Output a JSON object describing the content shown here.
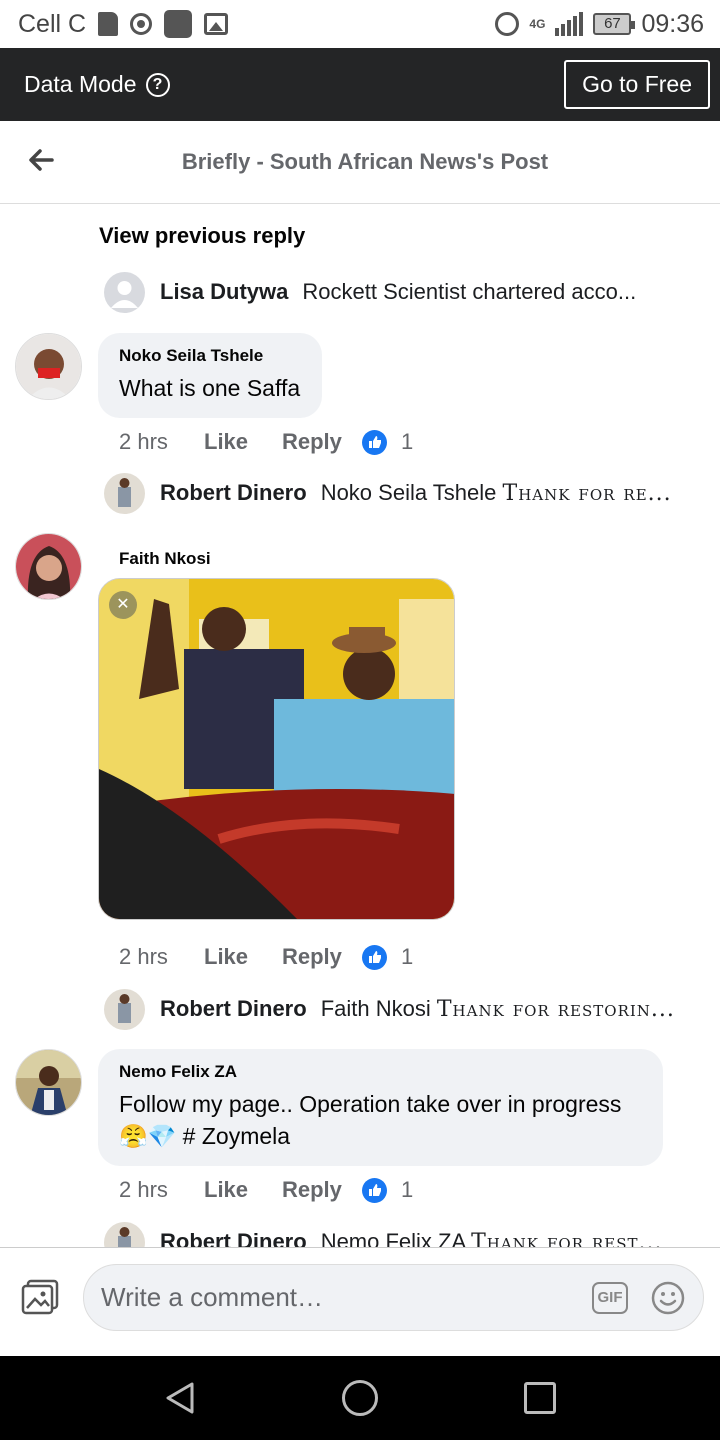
{
  "status_bar": {
    "carrier": "Cell C",
    "network": "4G",
    "battery": "67",
    "time": "09:36"
  },
  "data_mode": {
    "label": "Data Mode",
    "go_free_label": "Go to Free"
  },
  "header": {
    "title": "Briefly - South African News's Post"
  },
  "feed": {
    "view_previous_reply": "View previous reply",
    "reply_lisa": {
      "name": "Lisa Dutywa",
      "text": "Rockett Scientist chartered acco..."
    },
    "comment_noko": {
      "name": "Noko Seila Tshele",
      "text": "What is one Saffa",
      "time": "2 hrs",
      "like_label": "Like",
      "reply_label": "Reply",
      "reactions": "1"
    },
    "reply_robert_1": {
      "name": "Robert Dinero",
      "mention": "Noko Seila Tshele",
      "text": "Thank for re..."
    },
    "comment_faith": {
      "name": "Faith Nkosi",
      "time": "2 hrs",
      "like_label": "Like",
      "reply_label": "Reply",
      "reactions": "1"
    },
    "reply_robert_2": {
      "name": "Robert Dinero",
      "mention": "Faith Nkosi",
      "text": "Thank for restorin..."
    },
    "comment_nemo": {
      "name": "Nemo Felix ZA",
      "text_line1": "Follow my page.. Operation take over in progress",
      "text_line2": "# Zoymela",
      "emojis": "😤💎",
      "time": "2 hrs",
      "like_label": "Like",
      "reply_label": "Reply",
      "reactions": "1"
    },
    "reply_robert_3": {
      "name": "Robert Dinero",
      "mention": "Nemo Felix ZA",
      "text": "Thank for rest..."
    }
  },
  "composer": {
    "placeholder": "Write a comment…",
    "gif_label": "GIF"
  },
  "colors": {
    "like_blue": "#1877f2",
    "bubble_gray": "#f0f2f5",
    "data_bar": "#242526"
  }
}
